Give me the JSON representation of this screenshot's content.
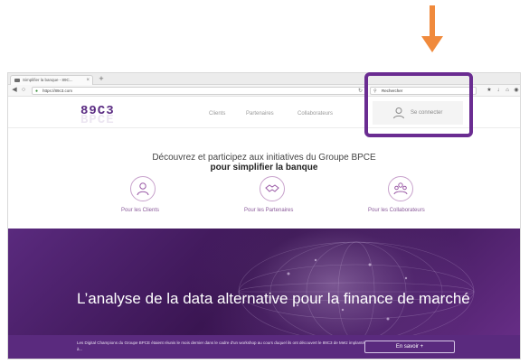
{
  "browser": {
    "tab_title": "Simplifier la banque - 89C...",
    "url": "https://89c3.com",
    "search_text": "Rechercher"
  },
  "site": {
    "logo_top": "89C3",
    "logo_bottom": "BPCE",
    "nav": [
      "Clients",
      "Partenaires",
      "Collaborateurs"
    ],
    "login_label": "Se connecter",
    "intro_line1": "Découvrez et participez aux initiatives du Groupe BPCE",
    "intro_line2": "pour simplifier la banque",
    "audiences": [
      {
        "label": "Pour les Clients",
        "icon": "person-icon"
      },
      {
        "label": "Pour les Partenaires",
        "icon": "handshake-icon"
      },
      {
        "label": "Pour les Collaborateurs",
        "icon": "group-icon"
      }
    ],
    "hero_title": "L’analyse de la data alternative pour la finance de marché",
    "hero_text": "Les Digital Champions du Groupe BPCE étaient réunis le mois dernier dans le cadre d'un workshop au cours duquel ils ont découvert le 89C3 de Metz implanté à...",
    "cta_label": "En savoir +"
  },
  "colors": {
    "brand_purple": "#5b2c83",
    "highlight": "#6a2c91",
    "arrow": "#f08a3c"
  }
}
